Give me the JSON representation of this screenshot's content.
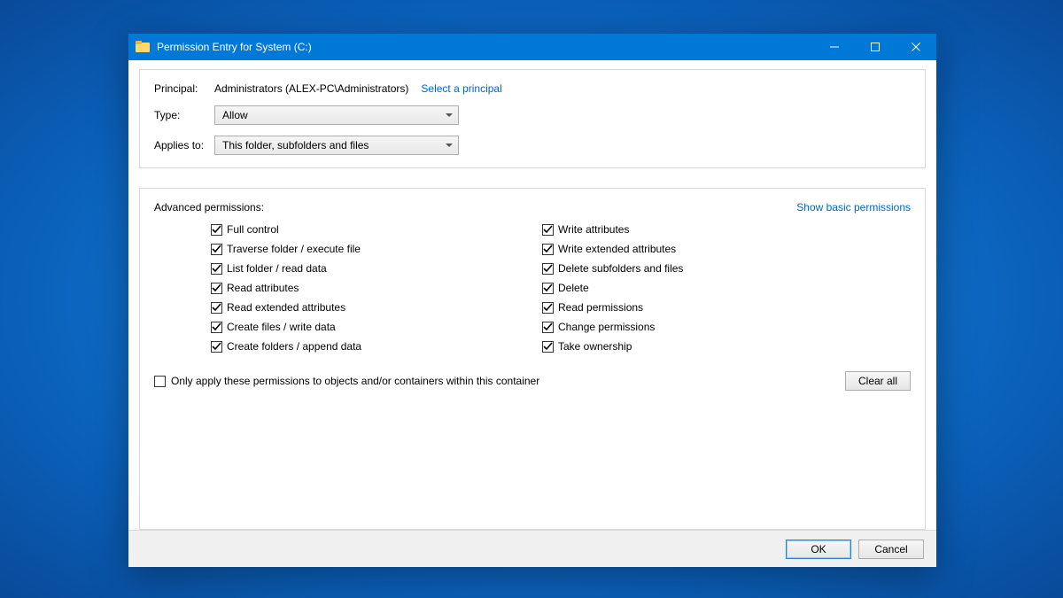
{
  "window": {
    "title": "Permission Entry for System (C:)"
  },
  "labels": {
    "principal": "Principal:",
    "type": "Type:",
    "applies_to": "Applies to:",
    "advanced_permissions": "Advanced permissions:",
    "show_basic": "Show basic permissions",
    "only_apply": "Only apply these permissions to objects and/or containers within this container",
    "clear_all": "Clear all",
    "ok": "OK",
    "cancel": "Cancel",
    "select_principal": "Select a principal"
  },
  "principal": {
    "value": "Administrators (ALEX-PC\\Administrators)"
  },
  "type": {
    "selected": "Allow"
  },
  "applies_to": {
    "selected": "This folder, subfolders and files"
  },
  "permissions_left": [
    {
      "label": "Full control",
      "checked": true
    },
    {
      "label": "Traverse folder / execute file",
      "checked": true
    },
    {
      "label": "List folder / read data",
      "checked": true
    },
    {
      "label": "Read attributes",
      "checked": true
    },
    {
      "label": "Read extended attributes",
      "checked": true
    },
    {
      "label": "Create files / write data",
      "checked": true
    },
    {
      "label": "Create folders / append data",
      "checked": true
    }
  ],
  "permissions_right": [
    {
      "label": "Write attributes",
      "checked": true
    },
    {
      "label": "Write extended attributes",
      "checked": true
    },
    {
      "label": "Delete subfolders and files",
      "checked": true
    },
    {
      "label": "Delete",
      "checked": true
    },
    {
      "label": "Read permissions",
      "checked": true
    },
    {
      "label": "Change permissions",
      "checked": true
    },
    {
      "label": "Take ownership",
      "checked": true
    }
  ],
  "only_apply_checked": false
}
